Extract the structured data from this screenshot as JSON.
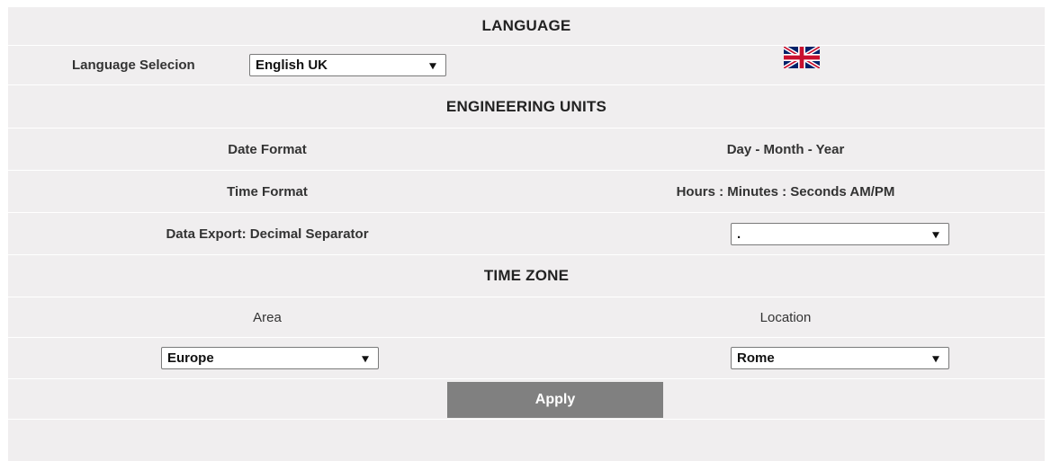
{
  "language": {
    "title": "LANGUAGE",
    "selection_label": "Language Selecion",
    "selected_language": "English UK",
    "flag_icon": "uk-flag-icon"
  },
  "engineering_units": {
    "title": "ENGINEERING UNITS",
    "date_format_label": "Date Format",
    "date_format_value": "Day - Month - Year",
    "time_format_label": "Time Format",
    "time_format_value": "Hours : Minutes : Seconds AM/PM",
    "decimal_separator_label": "Data Export: Decimal Separator",
    "decimal_separator_value": "."
  },
  "time_zone": {
    "title": "TIME ZONE",
    "area_label": "Area",
    "location_label": "Location",
    "area_value": "Europe",
    "location_value": "Rome"
  },
  "actions": {
    "apply_label": "Apply"
  },
  "colors": {
    "panel_bg": "#f0eeef",
    "apply_bg": "#808080",
    "flag_blue": "#012169",
    "flag_red": "#C8102E"
  }
}
